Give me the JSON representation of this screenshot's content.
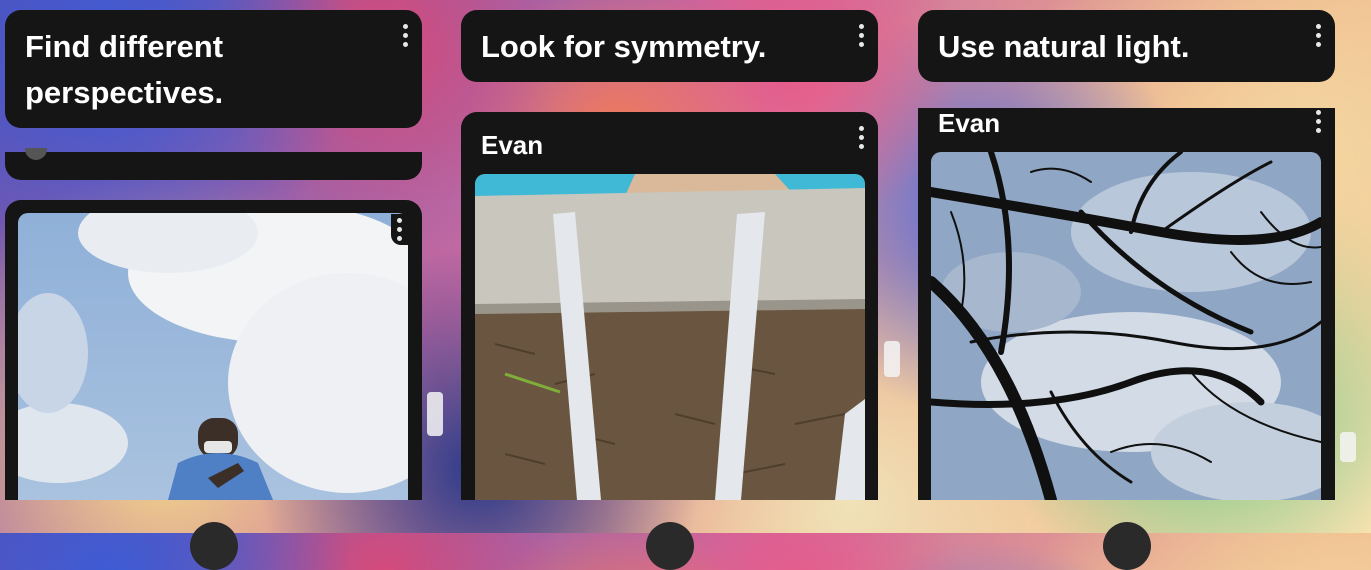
{
  "columns": [
    {
      "prompt": "Find different perspectives.",
      "author": ""
    },
    {
      "prompt": "Look for symmetry.",
      "author": "Evan"
    },
    {
      "prompt": "Use natural light.",
      "author": "Evan"
    }
  ],
  "icons": {
    "menu": "more-vertical-icon"
  },
  "colors": {
    "card": "#151515",
    "text": "#ffffff"
  }
}
